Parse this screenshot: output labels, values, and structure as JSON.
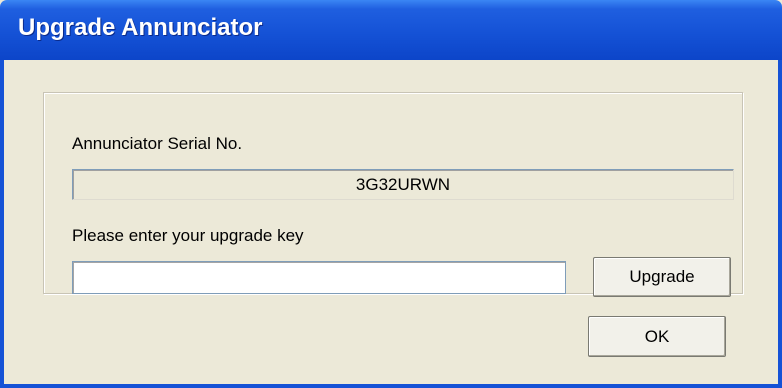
{
  "window": {
    "title": "Upgrade Annunciator"
  },
  "serial": {
    "label": "Annunciator Serial No.",
    "value": "3G32URWN"
  },
  "upgrade": {
    "label": "Please enter your upgrade key",
    "input_value": "",
    "button_label": "Upgrade"
  },
  "footer": {
    "ok_label": "OK"
  },
  "colors": {
    "titlebar": "#1552d6",
    "dialog_bg": "#ece9d8"
  }
}
